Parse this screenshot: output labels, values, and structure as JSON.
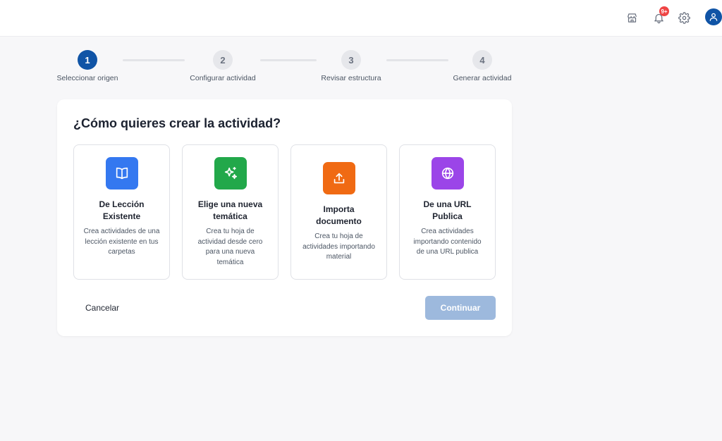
{
  "header": {
    "notifications_badge": "9+",
    "icons": [
      "store-icon",
      "bell-icon",
      "gear-icon",
      "user-icon"
    ],
    "avatar_color": "#1054a6"
  },
  "stepper": {
    "steps": [
      {
        "number": "1",
        "label": "Seleccionar origen",
        "active": true
      },
      {
        "number": "2",
        "label": "Configurar actividad",
        "active": false
      },
      {
        "number": "3",
        "label": "Revisar estructura",
        "active": false
      },
      {
        "number": "4",
        "label": "Generar actividad",
        "active": false
      }
    ],
    "active_color": "#1054a6"
  },
  "main": {
    "title": "¿Cómo quieres crear la actividad?",
    "options": [
      {
        "title": "De Lección Existente",
        "description": "Crea actividades de una lección existente en tus carpetas",
        "icon": "book-icon",
        "color": "#3478f0"
      },
      {
        "title": "Elige una nueva temática",
        "description": "Crea tu hoja de actividad desde cero para una nueva temática",
        "icon": "sparkles-icon",
        "color": "#22a84a"
      },
      {
        "title": "Importa documento",
        "description": "Crea tu hoja de actividades importando material",
        "icon": "upload-icon",
        "color": "#f06a13"
      },
      {
        "title": "De una URL Publica",
        "description": "Crea actividades importando contenido de una URL publica",
        "icon": "globe-icon",
        "color": "#9b45e8"
      }
    ],
    "cancel_label": "Cancelar",
    "continue_label": "Continuar",
    "continue_color": "#9db9dd"
  }
}
